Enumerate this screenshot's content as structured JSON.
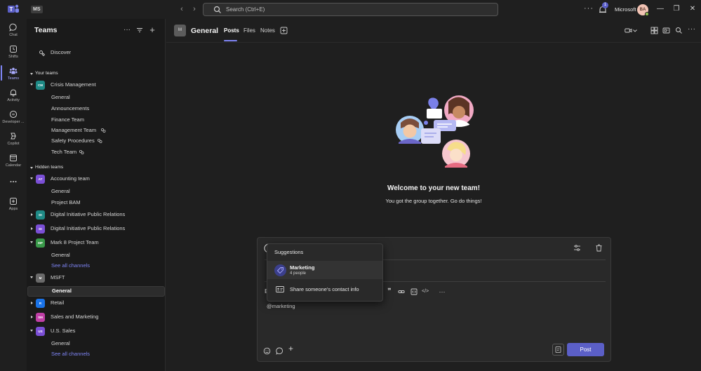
{
  "titlebar": {
    "tenant_tag": "MS",
    "search_placeholder": "Search (Ctrl+E)",
    "notification_count": "1",
    "org_name": "Microsoft",
    "avatar_initials": "BA"
  },
  "rail": [
    {
      "label": "Chat",
      "icon": "chat-icon"
    },
    {
      "label": "Shifts",
      "icon": "shifts-icon"
    },
    {
      "label": "Teams",
      "icon": "teams-icon",
      "active": true
    },
    {
      "label": "Activity",
      "icon": "bell-icon"
    },
    {
      "label": "Developer ...",
      "icon": "developer-icon"
    },
    {
      "label": "Copilot",
      "icon": "copilot-icon"
    },
    {
      "label": "Calendar",
      "icon": "calendar-icon"
    },
    {
      "label": "",
      "icon": "more-icon"
    },
    {
      "label": "Apps",
      "icon": "apps-icon"
    }
  ],
  "pane": {
    "title": "Teams",
    "discover_label": "Discover",
    "your_teams_label": "Your teams",
    "hidden_teams_label": "Hidden teams",
    "crisis": {
      "initials": "CM",
      "color": "#1f8a86",
      "name": "Crisis Management",
      "channels": [
        "General",
        "Announcements",
        "Finance Team",
        "Management Team",
        "Safety Procedures",
        "Tech Team"
      ]
    },
    "accounting": {
      "initials": "AT",
      "color": "#7b4fd6",
      "name": "Accounting team",
      "channels": [
        "General",
        "Project BAM"
      ]
    },
    "dipr1": {
      "initials": "DI",
      "color": "#1f8a86",
      "name": "Digital Initiative Public Relations"
    },
    "dipr2": {
      "initials": "DI",
      "color": "#7b4fd6",
      "name": "Digital Initiative Public Relations"
    },
    "mark8": {
      "initials": "MP",
      "color": "#3a9a4a",
      "name": "Mark 8 Project Team",
      "channels": [
        "General"
      ],
      "see_all": "See all channels"
    },
    "msft": {
      "initials": "M",
      "color": "#6a6a6a",
      "name": "MSFT",
      "channels": [
        "General"
      ]
    },
    "retail": {
      "initials": "R",
      "color": "#1a73e8",
      "name": "Retail"
    },
    "sales": {
      "initials": "SM",
      "color": "#c03fa6",
      "name": "Sales and Marketing"
    },
    "ussales": {
      "initials": "US",
      "color": "#7b4fd6",
      "name": "U.S. Sales",
      "channels": [
        "General"
      ],
      "see_all": "See all channels"
    }
  },
  "channel": {
    "avatar": "M",
    "name": "General",
    "tabs": [
      "Posts",
      "Files",
      "Notes"
    ]
  },
  "welcome": {
    "title": "Welcome to your new team!",
    "subtitle": "You got the group together. Go do things!"
  },
  "compose": {
    "text": "@marketing",
    "post_label": "Post"
  },
  "suggestions": {
    "title": "Suggestions",
    "item_name": "Marketing",
    "item_sub": "4 people",
    "share_label": "Share someone's contact info"
  },
  "colors": {
    "accent": "#5b5fc7",
    "accent_light": "#7f85f5",
    "background": "#1f1f1f"
  }
}
